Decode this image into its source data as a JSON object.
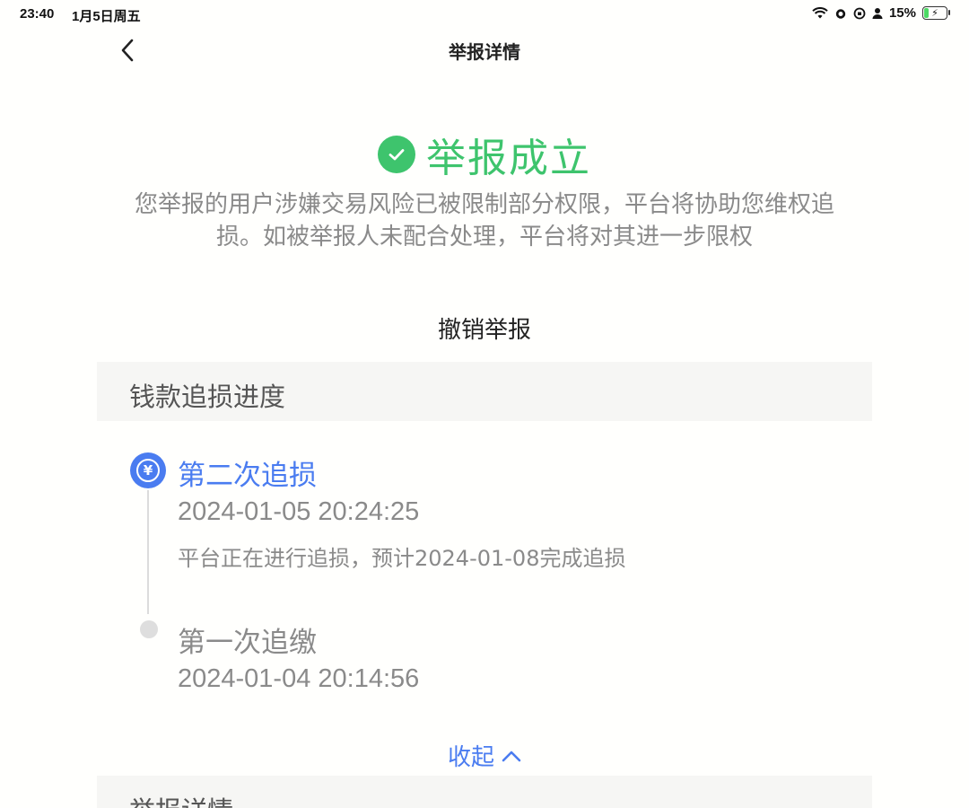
{
  "status_bar": {
    "time": "23:40",
    "date": "1月5日周五",
    "battery": "15%",
    "icons": [
      "wifi-icon",
      "alarm-icon",
      "rotation-lock-icon",
      "person-icon",
      "battery-charging-icon"
    ]
  },
  "nav": {
    "title": "举报详情",
    "back_icon": "chevron-left-icon"
  },
  "result": {
    "title": "举报成立",
    "icon": "check-circle-icon",
    "color": "#3ec46d",
    "description": "您举报的用户涉嫌交易风险已被限制部分权限，平台将协助您维权追损。如被举报人未配合处理，平台将对其进一步限权"
  },
  "revoke_label": "撤销举报",
  "recovery": {
    "section_title": "钱款追损进度",
    "accent_color": "#4a7cf0",
    "steps": [
      {
        "title": "第二次追损",
        "time": "2024-01-05 20:24:25",
        "note": "平台正在进行追损，预计2024-01-08完成追损",
        "icon": "yuan-refund-icon"
      },
      {
        "title": "第一次追缴",
        "time": "2024-01-04 20:14:56"
      }
    ],
    "collapse_label": "收起"
  },
  "details_section_title": "举报详情"
}
